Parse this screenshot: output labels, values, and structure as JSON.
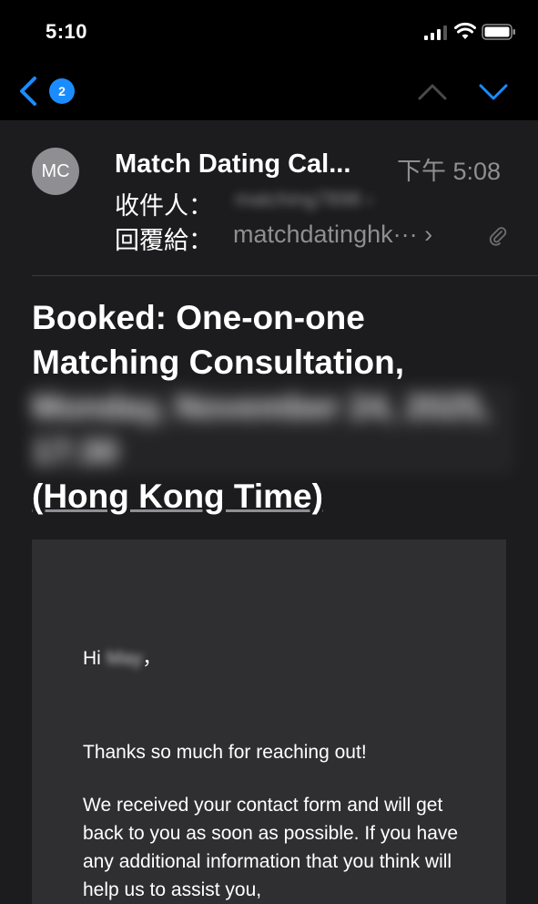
{
  "status": {
    "time": "5:10"
  },
  "nav": {
    "unread_count": "2"
  },
  "message": {
    "avatar_initials": "MC",
    "sender": "Match Dating Cal...",
    "time": "下午 5:08",
    "to_label": "收件人：",
    "to_value": "matching7898 ›",
    "reply_to_label": "回覆給：",
    "reply_to_value": "matchdatinghk··· ›",
    "subject_line1": "Booked: One-on-one",
    "subject_line2": "Matching Consultation,",
    "subject_date": "Monday, November 24, 2025, 17:30",
    "subject_timezone": "(Hong Kong Time)"
  },
  "body": {
    "greeting_prefix": "Hi",
    "greeting_name": "May",
    "greeting_suffix": "，",
    "thanks": "Thanks so much for reaching out!",
    "paragraph": "We received your contact form and will get back to you as soon as possible. If you have any additional information that you think will help us to assist you,"
  },
  "colors": {
    "accent": "#1a8cff",
    "background": "#1c1c1e",
    "body_card": "#2f2f31",
    "secondary_text": "#8e8e93"
  },
  "icons": [
    "signal-icon",
    "wifi-icon",
    "battery-icon",
    "chevron-left-icon",
    "chevron-up-icon",
    "chevron-down-icon",
    "paperclip-icon"
  ]
}
